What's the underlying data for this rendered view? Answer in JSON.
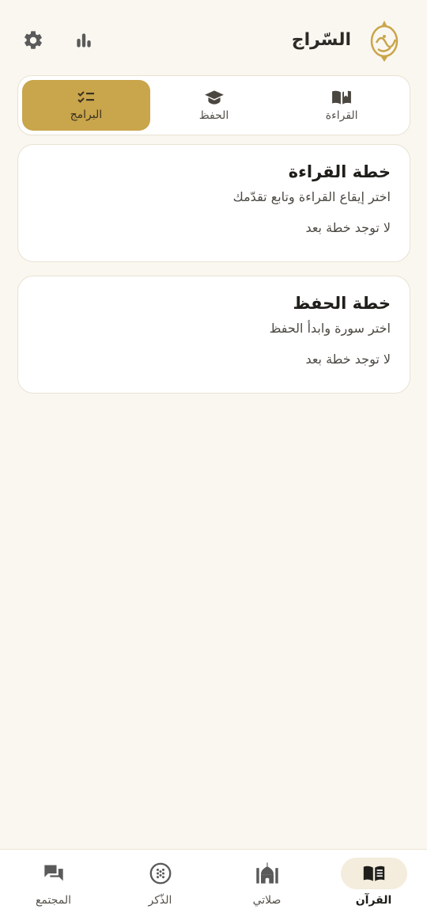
{
  "header": {
    "title": "السّراج"
  },
  "tabs": [
    {
      "label": "القراءة",
      "icon": "open-book-icon",
      "active": false
    },
    {
      "label": "الحفظ",
      "icon": "graduation-cap-icon",
      "active": false
    },
    {
      "label": "البرامج",
      "icon": "checklist-icon",
      "active": true
    }
  ],
  "cards": {
    "reading": {
      "title": "خطة القراءة",
      "subtitle": "اختر إيقاع القراءة وتابع تقدّمك",
      "empty": "لا توجد خطة بعد"
    },
    "memorization": {
      "title": "خطة الحفظ",
      "subtitle": "اختر سورة وابدأ الحفظ",
      "empty": "لا توجد خطة بعد"
    }
  },
  "bottom_nav": [
    {
      "label": "القرآن",
      "icon": "quran-book-icon",
      "active": true
    },
    {
      "label": "صلاتي",
      "icon": "mosque-icon",
      "active": false
    },
    {
      "label": "الذّكر",
      "icon": "prayer-beads-icon",
      "active": false
    },
    {
      "label": "المجتمع",
      "icon": "chat-bubbles-icon",
      "active": false
    }
  ],
  "colors": {
    "accent": "#c9a54b",
    "background": "#faf7f0",
    "card": "#ffffff",
    "text": "#2b2a26",
    "icon": "#5a5a5a"
  }
}
